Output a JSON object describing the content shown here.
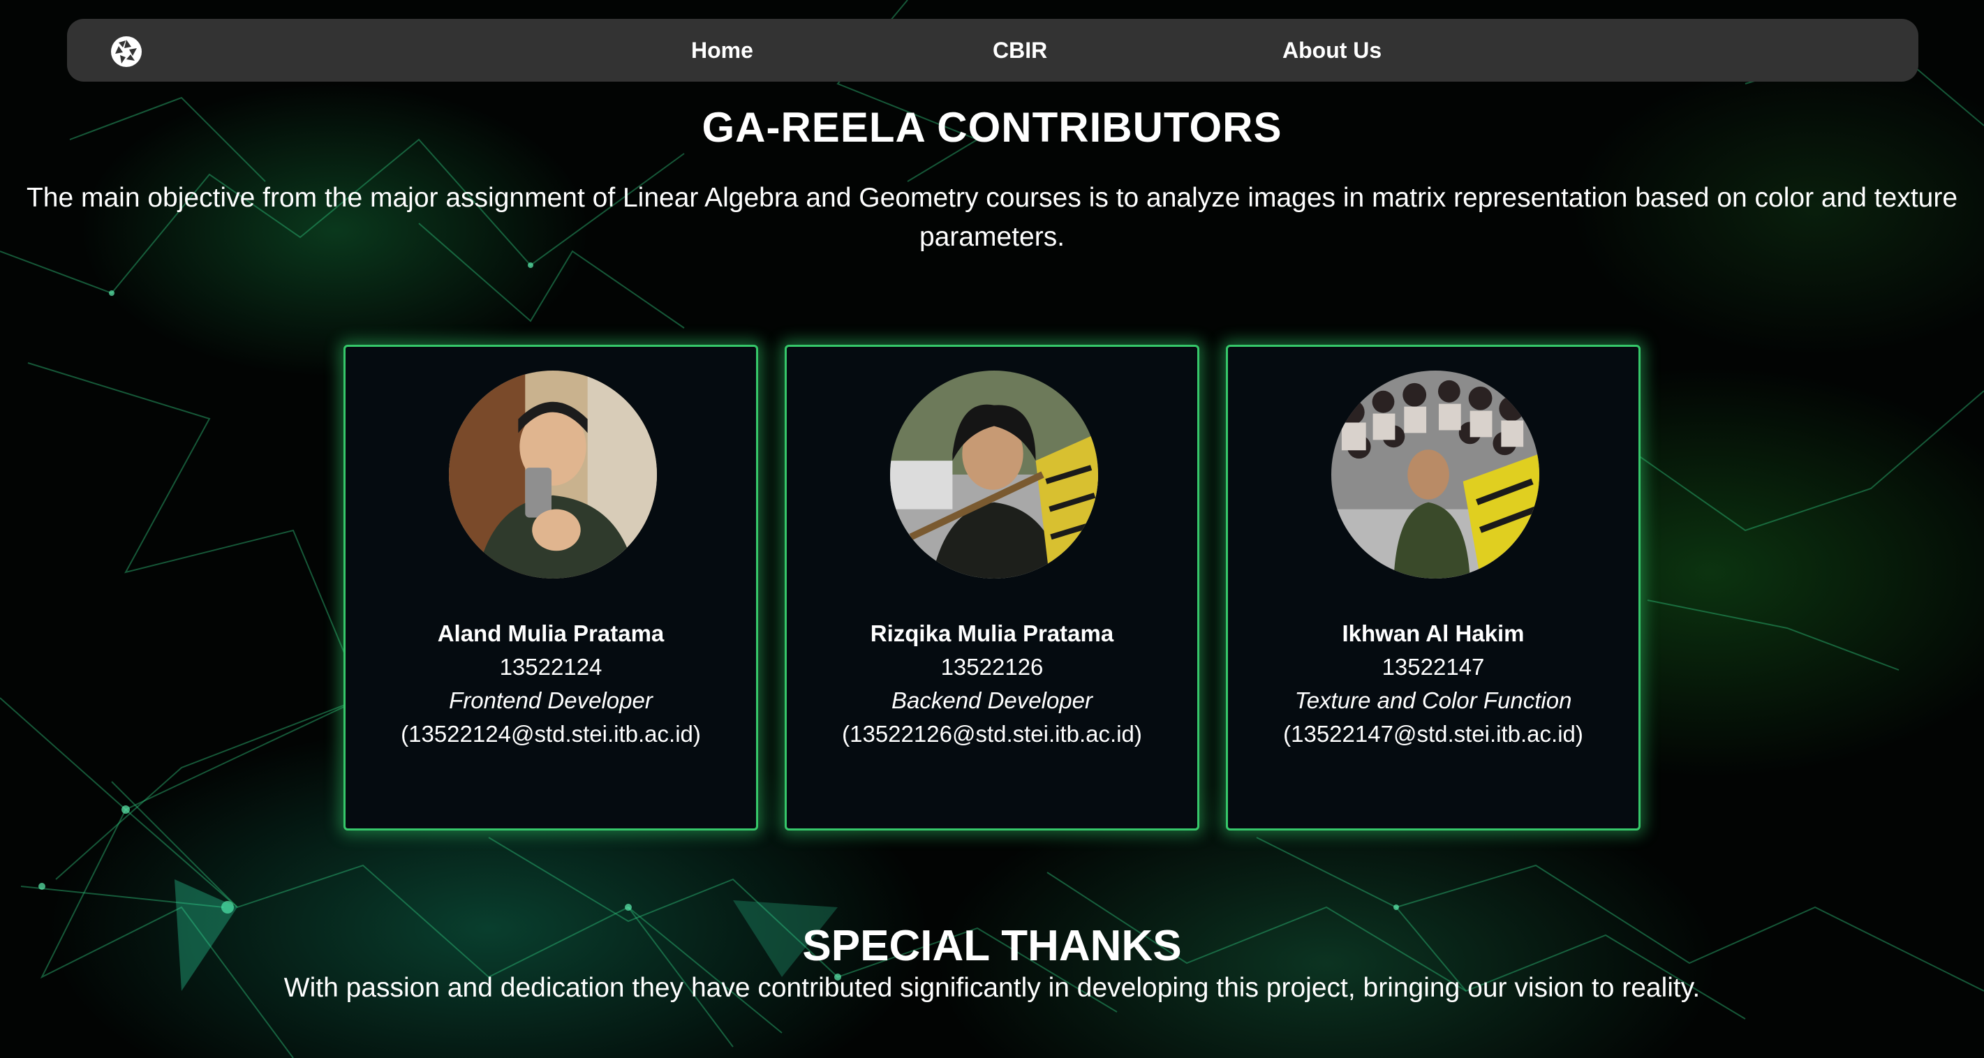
{
  "nav": {
    "logo_icon": "camera-aperture-icon",
    "links": [
      {
        "label": "Home"
      },
      {
        "label": "CBIR"
      },
      {
        "label": "About Us"
      }
    ]
  },
  "main": {
    "title": "GA-REELA CONTRIBUTORS",
    "intro": "The main objective from the major assignment of Linear Algebra and Geometry courses is to analyze images in matrix representation based on color and texture parameters."
  },
  "contributors": [
    {
      "name": "Aland Mulia Pratama",
      "nim": "13522124",
      "role": "Frontend Developer",
      "email": "(13522124@std.stei.itb.ac.id)"
    },
    {
      "name": "Rizqika Mulia Pratama",
      "nim": "13522126",
      "role": "Backend Developer",
      "email": "(13522126@std.stei.itb.ac.id)"
    },
    {
      "name": "Ikhwan Al Hakim",
      "nim": "13522147",
      "role": "Texture and Color Function",
      "email": "(13522147@std.stei.itb.ac.id)"
    }
  ],
  "thanks": {
    "title": "SPECIAL THANKS",
    "text": "With passion and dedication they have contributed significantly in developing this project, bringing our vision to reality."
  },
  "colors": {
    "accent": "#36c76a",
    "navbar": "#333333",
    "card_bg": "#050b10"
  }
}
